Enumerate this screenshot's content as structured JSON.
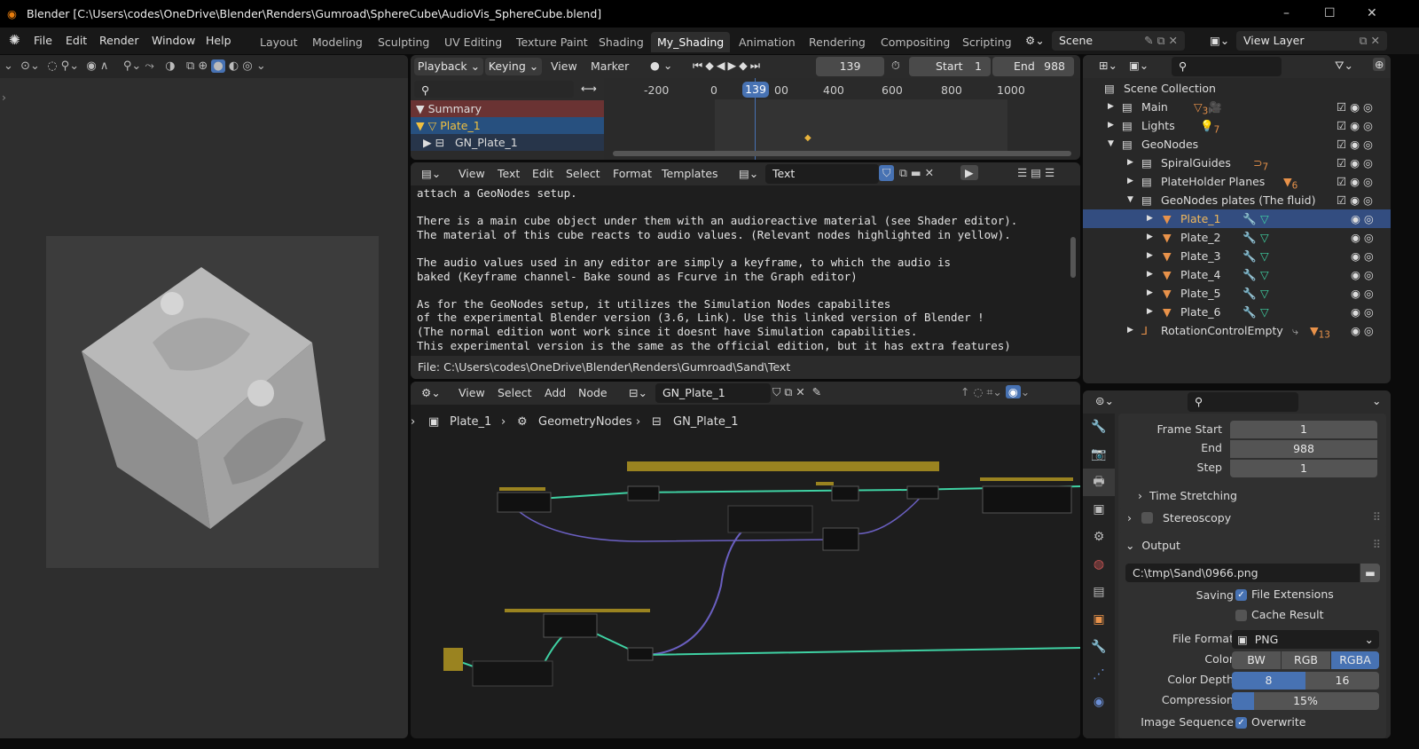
{
  "window": {
    "title": "Blender [C:\\Users\\codes\\OneDrive\\Blender\\Renders\\Gumroad\\SphereCube\\AudioVis_SphereCube.blend]",
    "minimize": "–",
    "maximize": "☐",
    "close": "✕"
  },
  "menu": [
    "File",
    "Edit",
    "Render",
    "Window",
    "Help"
  ],
  "workspaces": [
    "Layout",
    "Modeling",
    "Sculpting",
    "UV Editing",
    "Texture Paint",
    "Shading",
    "My_Shading",
    "Animation",
    "Rendering",
    "Compositing",
    "Scripting"
  ],
  "active_workspace": "My_Shading",
  "scene": "Scene",
  "view_layer": "View Layer",
  "timeline": {
    "menus": [
      "Playback",
      "Keying",
      "View",
      "Marker"
    ],
    "current_frame": "139",
    "start_label": "Start",
    "start": "1",
    "end_label": "End",
    "end": "988",
    "ruler": [
      "-200",
      "0",
      "00",
      "400",
      "600",
      "800",
      "1000"
    ],
    "channels": [
      "Summary",
      "Plate_1",
      "GN_Plate_1"
    ]
  },
  "text_editor": {
    "menus": [
      "View",
      "Text",
      "Edit",
      "Select",
      "Format",
      "Templates"
    ],
    "datablock": "Text",
    "lines": [
      "attach a GeoNodes setup.",
      "",
      "There is a main cube object under them with an audioreactive material (see Shader editor).",
      "The material of this cube reacts to audio values. (Relevant nodes highlighted in yellow).",
      "",
      "The audio values used in any editor are simply a keyframe, to which the audio is",
      "baked (Keyframe channel- Bake sound as Fcurve in the Graph editor)",
      "",
      "As for the GeoNodes setup, it utilizes the Simulation Nodes capabilites",
      "of the experimental Blender version (3.6, Link). Use this linked version of Blender !",
      "(The normal edition wont work since it doesnt have Simulation capabilities.",
      "This experimental version is the same as the official edition, but it has extra features)"
    ],
    "footer": "File: C:\\Users\\codes\\OneDrive\\Blender\\Renders\\Gumroad\\Sand\\Text"
  },
  "node_editor": {
    "menus": [
      "View",
      "Select",
      "Add",
      "Node"
    ],
    "node_tree": "GN_Plate_1",
    "breadcrumb": [
      "Plate_1",
      "GeometryNodes",
      "GN_Plate_1"
    ]
  },
  "outliner": {
    "items": [
      {
        "name": "Scene Collection",
        "depth": 0,
        "badge": ""
      },
      {
        "name": "Main",
        "depth": 1,
        "badge": "3"
      },
      {
        "name": "Lights",
        "depth": 1,
        "badge": "7"
      },
      {
        "name": "GeoNodes",
        "depth": 1,
        "badge": ""
      },
      {
        "name": "SpiralGuides",
        "depth": 2,
        "badge": "7"
      },
      {
        "name": "PlateHolder Planes",
        "depth": 2,
        "badge": "6"
      },
      {
        "name": "GeoNodes plates (The fluid)",
        "depth": 2,
        "badge": ""
      },
      {
        "name": "Plate_1",
        "depth": 3,
        "badge": "",
        "selected": true
      },
      {
        "name": "Plate_2",
        "depth": 3,
        "badge": ""
      },
      {
        "name": "Plate_3",
        "depth": 3,
        "badge": ""
      },
      {
        "name": "Plate_4",
        "depth": 3,
        "badge": ""
      },
      {
        "name": "Plate_5",
        "depth": 3,
        "badge": ""
      },
      {
        "name": "Plate_6",
        "depth": 3,
        "badge": ""
      },
      {
        "name": "RotationControlEmpty",
        "depth": 2,
        "badge": "13"
      }
    ]
  },
  "properties": {
    "frame_start_label": "Frame Start",
    "frame_start": "1",
    "end_label": "End",
    "end": "988",
    "step_label": "Step",
    "step": "1",
    "time_stretching": "Time Stretching",
    "stereoscopy": "Stereoscopy",
    "output": "Output",
    "path": "C:\\tmp\\Sand\\0966.png",
    "saving_label": "Saving",
    "file_extensions": "File Extensions",
    "cache_result": "Cache Result",
    "file_format_label": "File Format",
    "file_format": "PNG",
    "color_label": "Color",
    "color_options": [
      "BW",
      "RGB",
      "RGBA"
    ],
    "color_selected": "RGBA",
    "color_depth_label": "Color Depth",
    "depth_options": [
      "8",
      "16"
    ],
    "depth_selected": "8",
    "compression_label": "Compression",
    "compression": "15%",
    "compression_value": 0.15,
    "image_sequence_label": "Image Sequence",
    "overwrite": "Overwrite"
  },
  "colors": {
    "accent": "#4772b3",
    "selection": "#334d80",
    "object_orange": "#e8924a",
    "modifier_blue": "#6b8fd6",
    "geometry_green": "#3fd1a3",
    "keyframe": "#e8b33c"
  }
}
